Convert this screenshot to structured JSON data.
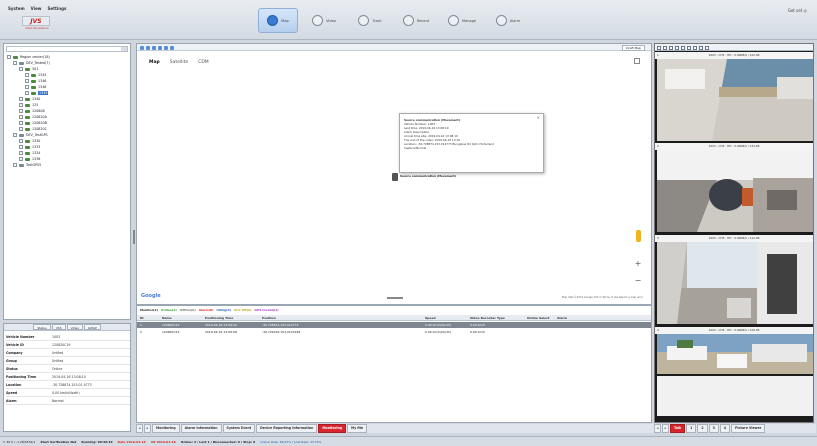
{
  "menu": [
    "System",
    "View",
    "Settings"
  ],
  "logo": {
    "text": "JVS",
    "subtitle": "Video Surveillance"
  },
  "top_right": "Get set ◎",
  "nav_tabs": [
    {
      "label": "Map",
      "active": true
    },
    {
      "label": "Video",
      "active": false
    },
    {
      "label": "Track",
      "active": false
    },
    {
      "label": "Record",
      "active": false
    },
    {
      "label": "Manage",
      "active": false
    },
    {
      "label": "Alarm",
      "active": false
    }
  ],
  "tree": {
    "root": "Region center(18)",
    "nodes": [
      {
        "label": "DEV_Tested(7)",
        "indent": 1
      },
      {
        "label": "301",
        "indent": 2
      },
      {
        "label": "1345",
        "indent": 3
      },
      {
        "label": "1346",
        "indent": 3
      },
      {
        "label": "1348",
        "indent": 3
      },
      {
        "label": "1349",
        "indent": 3,
        "selected": true
      },
      {
        "label": "1340",
        "indent": 2
      },
      {
        "label": "125",
        "indent": 2
      },
      {
        "label": "120808",
        "indent": 2
      },
      {
        "label": "120820A",
        "indent": 2
      },
      {
        "label": "120820B",
        "indent": 2
      },
      {
        "label": "120820C",
        "indent": 2
      },
      {
        "label": "DEV_TestGPS",
        "indent": 1
      },
      {
        "label": "1330",
        "indent": 2
      },
      {
        "label": "1333",
        "indent": 2
      },
      {
        "label": "1334",
        "indent": 2
      },
      {
        "label": "1336",
        "indent": 2
      },
      {
        "label": "TestGPS5",
        "indent": 1
      }
    ]
  },
  "info_tabs": [
    "Status",
    "VSS",
    "Video",
    "GMAP"
  ],
  "vehicle_info": [
    {
      "k": "Vehicle Number",
      "v": "1003"
    },
    {
      "k": "Vehicle ID",
      "v": "120820C19"
    },
    {
      "k": "Company",
      "v": "Unified"
    },
    {
      "k": "Group",
      "v": "Unified"
    },
    {
      "k": "Status",
      "v": "Online"
    },
    {
      "k": "Positioning Time",
      "v": "2019-04-16 13:08:10"
    },
    {
      "k": "Location",
      "v": "-30.728874,153.01 4773"
    },
    {
      "k": "Speed",
      "v": "0.00 km/h(North)"
    },
    {
      "k": "Alarm",
      "v": "Normal"
    }
  ],
  "map": {
    "types": [
      "Map",
      "Satellite",
      "CDM"
    ],
    "tab_label": "Draft Map",
    "popup": {
      "title": "Source communication (Movement)",
      "lines": [
        "Vehicle Number: 1003",
        "Last time: 2019-04-16 13:08:10",
        "Alarm Description:",
        "Arrival time site: 2019-04-16 13:08:10",
        "The end of the video: 2019-04-16 13:16",
        "Location: -30.728874,153.014773 Bungalow Rd QLD, Hinterland",
        "Capture/Normal"
      ]
    },
    "marker_label": "Source communication (Movement)",
    "google": "Google",
    "footer": "Map data ©2019 Google  100 m  Terms of Use  Report a map error"
  },
  "legend": [
    "Monitor(2)",
    "Online(2)",
    "Offline(0)",
    "Alarm(0)",
    "Idling(0)",
    "ACC Off(0)",
    "GPS Invalid(1)"
  ],
  "table": {
    "headers": [
      "ID",
      "Name",
      "Positioning Time",
      "Position",
      "Speed",
      "Video Recorder Type",
      "Online Select",
      "Alarm"
    ],
    "rows": [
      [
        "1",
        "120820C19",
        "2019-04-16 13:08:10",
        "-30.728874,153.014773",
        "0.00 km/h(North)",
        "0.00 km/h",
        "",
        ""
      ],
      [
        "2",
        "120820C19",
        "2019-04-16 13:08:08",
        "-30.729016,153.0143189",
        "0.00 km/h(North)",
        "0.00 km/h",
        "",
        ""
      ]
    ]
  },
  "bottom_tabs": [
    "Monitoring",
    "Alarm Information",
    "System Event",
    "Device Reporting Information",
    "Monitoring",
    "My file"
  ],
  "video": {
    "channels": [
      {
        "num": "1",
        "label": "1003 - CH1 - HD : 0.00KB/S / 122.08"
      },
      {
        "num": "2",
        "label": "1003 - CH2 - HD : 0.00KB/S / 134.08"
      },
      {
        "num": "3",
        "label": "1003 - CH3 - HD : 0.00KB/S / 112.08"
      },
      {
        "num": "4",
        "label": "1003 - CH4 - HD : 0.00KB/S / 120.08"
      }
    ],
    "tabs": [
      "Talk",
      "1",
      "2",
      "3",
      "4",
      "Picture Viewer"
    ]
  },
  "status": {
    "items": [
      "Y: 30.5 / -1.28/4554/1",
      "Start Verification Net",
      "Running: 00:36:49",
      "Date 2019-04-16",
      "Alt 2019-04-16",
      "Online: 2 / Lost 1 / Disconnected: 0 / Stop: 0",
      "Online Rate: 66.67% / Lost Rate: 33.33%"
    ]
  }
}
